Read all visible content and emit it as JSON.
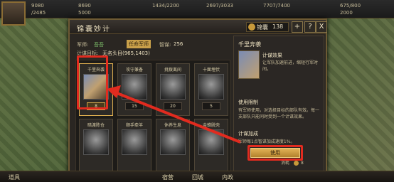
{
  "top_resources": {
    "row1": [
      "9080",
      "8690",
      "1434/2200",
      "2697/3033",
      "7707/7400",
      "675/800"
    ],
    "row2": [
      "/2485",
      "5000",
      "2000"
    ]
  },
  "modal": {
    "title": "锦囊妙计",
    "gold_label": "锦囊",
    "gold_value": "138",
    "help": "?",
    "close": "X",
    "army_label": "军师:",
    "army_value": "吾吾",
    "army_badge": "任命军师",
    "wisdom_label": "智谋:",
    "wisdom_value": "256",
    "target_label": "计谋目标:",
    "target_value": "无名头目(965,1403)"
  },
  "cards": [
    {
      "name": "千里奔袭",
      "cost": "8"
    },
    {
      "name": "攻守兼备",
      "cost": "15"
    },
    {
      "name": "挑拨离间",
      "cost": "20"
    },
    {
      "name": "十面埋伏",
      "cost": "5"
    },
    {
      "name": "暗渡陈仓",
      "cost": ""
    },
    {
      "name": "顺手牵羊",
      "cost": ""
    },
    {
      "name": "休养生息",
      "cost": ""
    },
    {
      "name": "金蝉脱壳",
      "cost": ""
    }
  ],
  "detail": {
    "title": "千里奔袭",
    "effect_title": "计谋效果",
    "effect_text": "让军队加速前进，缩短行军时间。",
    "limit_title": "使用限制",
    "limit_text": "有军师使用，对选择目标的部队有效。每一支部队只能同时受到一个计谋效果。",
    "bonus_title": "计谋加成",
    "bonus_text": "军师每1点智谋加成速度1%。",
    "cost_label": "消耗",
    "cost_value": "8",
    "use_button": "使用"
  },
  "bottom": {
    "tab1": "宿营",
    "tab2": "回城",
    "tab3": "内政",
    "left_label": "道具"
  },
  "colors": {
    "highlight": "#e12b1f",
    "gold": "#e2b256"
  }
}
